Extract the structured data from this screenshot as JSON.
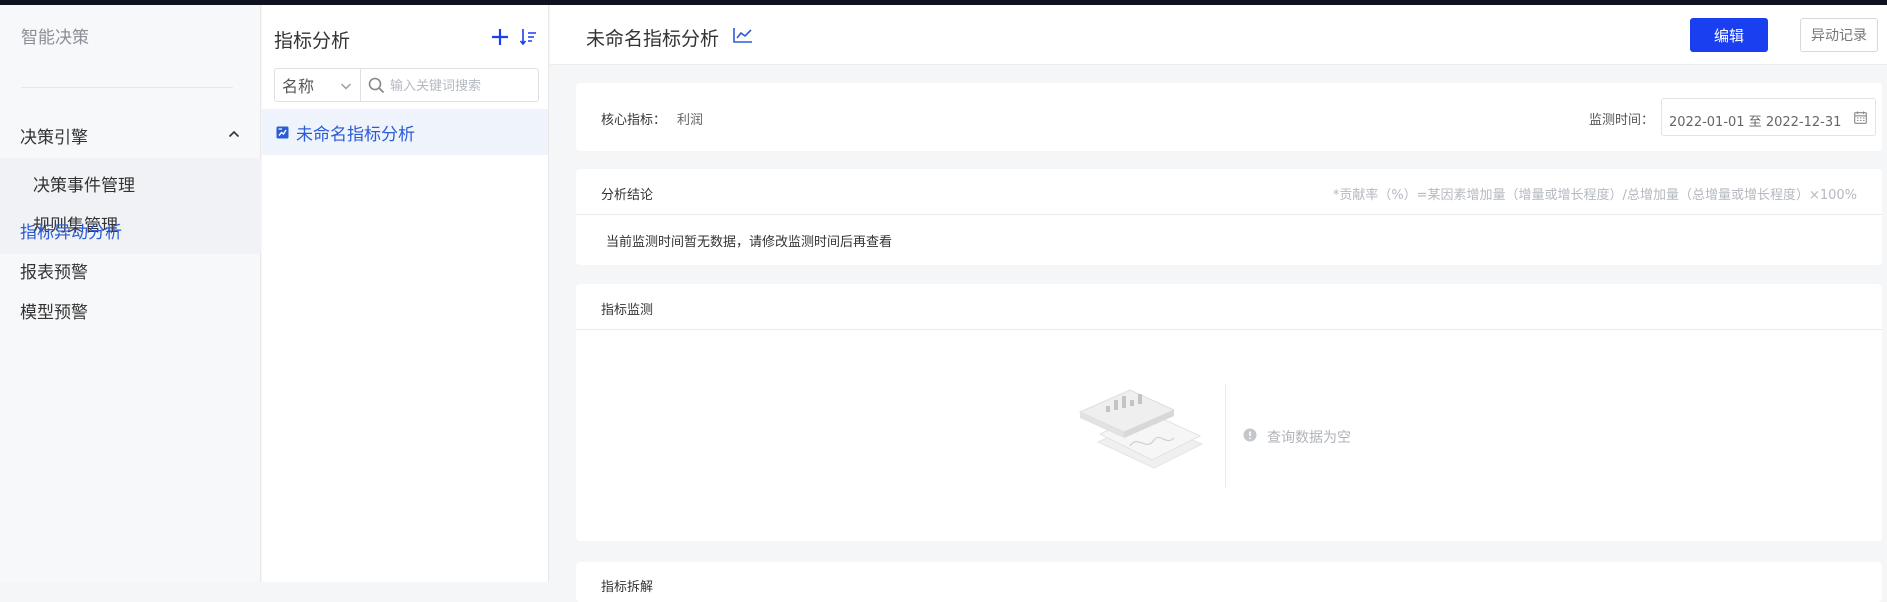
{
  "sidebar": {
    "brand": "智能决策",
    "group": {
      "label": "决策引擎",
      "items": [
        "决策事件管理",
        "规则集管理"
      ]
    },
    "items": [
      {
        "label": "指标异动分析",
        "active": true
      },
      {
        "label": "报表预警"
      },
      {
        "label": "模型预警"
      }
    ]
  },
  "list_panel": {
    "title": "指标分析",
    "filter": {
      "selected": "名称"
    },
    "search": {
      "placeholder": "输入关键词搜索",
      "value": ""
    },
    "items": [
      {
        "label": "未命名指标分析",
        "selected": true
      }
    ]
  },
  "header": {
    "title": "未命名指标分析",
    "edit_label": "编辑",
    "log_label": "异动记录"
  },
  "core": {
    "metric_label": "核心指标：",
    "metric_value": "利润",
    "time_label": "监测时间：",
    "date_range": "2022-01-01 至 2022-12-31"
  },
  "conclusion": {
    "title": "分析结论",
    "note": "*贡献率（%）=某因素增加量（增量或增长程度）/总增加量（总增量或增长程度）×100%",
    "message": "当前监测时间暂无数据，请修改监测时间后再查看"
  },
  "monitor": {
    "title": "指标监测",
    "empty_text": "查询数据为空"
  },
  "next_section": {
    "title": "指标拆解"
  },
  "colors": {
    "primary": "#1a3ff0",
    "active_text": "#2b5cd6",
    "selected_bg": "#eef3fc"
  },
  "icons": [
    "chevron-up-icon",
    "plus-icon",
    "sort-icon",
    "chevron-down-icon",
    "search-icon",
    "chart-doc-icon",
    "line-chart-icon",
    "calendar-icon",
    "info-icon",
    "empty-data-illustration"
  ]
}
